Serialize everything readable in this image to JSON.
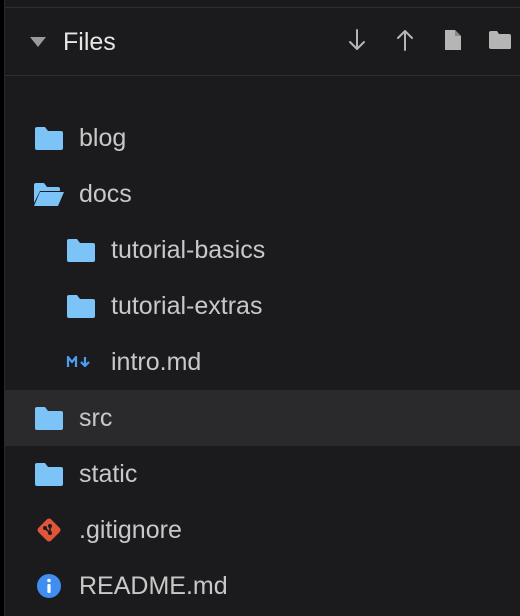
{
  "explorer": {
    "title": "Files",
    "actions": [
      {
        "name": "download-button",
        "icon": "arrow-down-icon"
      },
      {
        "name": "upload-button",
        "icon": "arrow-up-icon"
      },
      {
        "name": "new-file-button",
        "icon": "file-icon"
      },
      {
        "name": "new-folder-button",
        "icon": "folder-icon"
      }
    ]
  },
  "tree": [
    {
      "label": "blog",
      "type": "folder",
      "icon": "folder-icon",
      "depth": 0,
      "expanded": false
    },
    {
      "label": "docs",
      "type": "folder",
      "icon": "folder-open-icon",
      "depth": 0,
      "expanded": true
    },
    {
      "label": "tutorial-basics",
      "type": "folder",
      "icon": "folder-icon",
      "depth": 1,
      "expanded": false
    },
    {
      "label": "tutorial-extras",
      "type": "folder",
      "icon": "folder-icon",
      "depth": 1,
      "expanded": false
    },
    {
      "label": "intro.md",
      "type": "file",
      "icon": "markdown-icon",
      "depth": 1
    },
    {
      "label": "src",
      "type": "folder",
      "icon": "folder-icon",
      "depth": 0,
      "expanded": false,
      "selected": true
    },
    {
      "label": "static",
      "type": "folder",
      "icon": "folder-icon",
      "depth": 0,
      "expanded": false
    },
    {
      "label": ".gitignore",
      "type": "file",
      "icon": "git-icon",
      "depth": 0
    },
    {
      "label": "README.md",
      "type": "file",
      "icon": "info-icon",
      "depth": 0
    }
  ],
  "colors": {
    "background": "#1b1b1d",
    "selected_row": "#2a2a2c",
    "folder": "#7cc4f8",
    "markdown": "#4a9ff5",
    "git": "#e0543a",
    "info": "#3f8ef0",
    "text": "#c8c8c8"
  }
}
